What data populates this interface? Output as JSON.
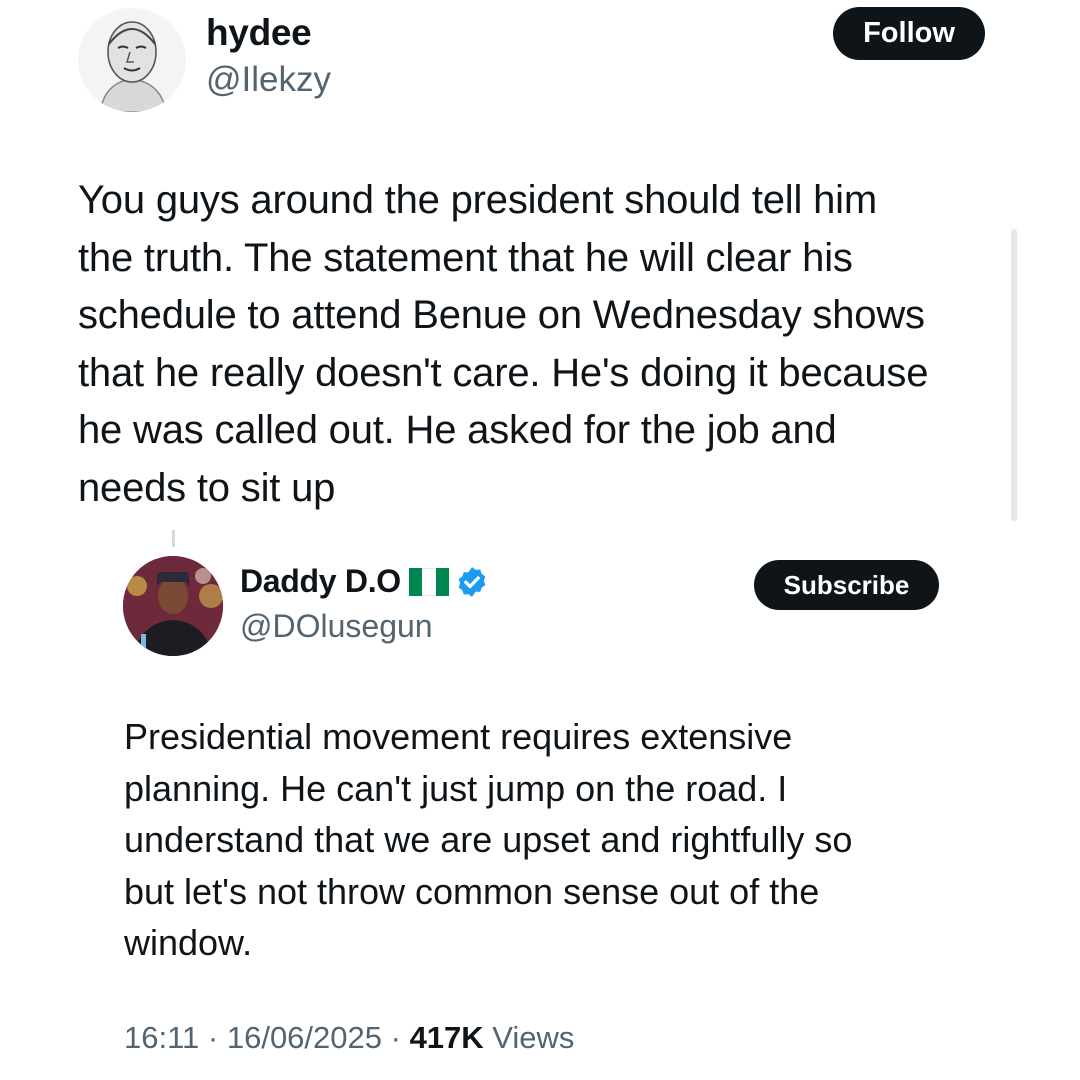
{
  "tweet": {
    "author": {
      "name": "hydee",
      "handle": "@Ilekzy"
    },
    "follow_label": "Follow",
    "text": "You guys around the president should tell him\nthe truth. The statement that he will clear his\nschedule to attend Benue on Wednesday shows\nthat he really doesn't care. He's doing it because\nhe was called out. He asked for the job and\nneeds to sit up"
  },
  "quoted_tweet": {
    "author": {
      "name": "Daddy D.O",
      "handle": "@DOlusegun",
      "flag": "nigeria-flag",
      "verified": true
    },
    "subscribe_label": "Subscribe",
    "text": "Presidential movement requires extensive\nplanning. He can't just jump on the road. I\nunderstand that we are upset and rightfully so\nbut let's not throw common sense out of the\nwindow."
  },
  "meta": {
    "time": "16:11",
    "separator": " · ",
    "date": "16/06/2025",
    "views_count": "417K",
    "views_label": "Views"
  },
  "icons": {
    "verified": "verified-badge-icon",
    "flag": "nigeria-flag-icon"
  },
  "colors": {
    "text": "#0f1419",
    "muted": "#536471",
    "button_bg": "#0f1419",
    "verified": "#1d9bf0",
    "flag_green": "#008751"
  }
}
